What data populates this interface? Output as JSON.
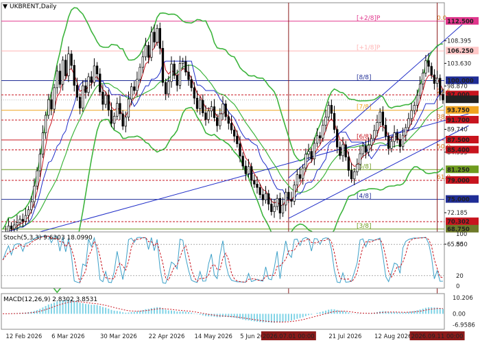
{
  "header": {
    "title_icon": "triangle-down-icon",
    "symbol": "UKBRENT,Daily"
  },
  "chart_data": {
    "type": "line",
    "chart_style": "candlestick",
    "ylim": [
      65.55,
      113.5
    ],
    "y_ticks": [
      {
        "label": "112.500",
        "value": 112.5,
        "boxed": true,
        "color": "#e0368c"
      },
      {
        "label": "108.395",
        "value": 108.395
      },
      {
        "label": "106.250",
        "value": 106.25,
        "boxed": true,
        "color": "#ffc8c8"
      },
      {
        "label": "103.630",
        "value": 103.63
      },
      {
        "label": "100.000",
        "value": 100.0,
        "boxed": true,
        "color": "#1f2d96"
      },
      {
        "label": "98.870",
        "value": 98.87
      },
      {
        "label": "97.000",
        "value": 97.0,
        "boxed": true,
        "color": "#c8141e"
      },
      {
        "label": "95.994",
        "value": 95.994,
        "boxed": true,
        "color": "#222222"
      },
      {
        "label": "93.750",
        "value": 93.75,
        "boxed": true,
        "color": "#f0a31e"
      },
      {
        "label": "91.700",
        "value": 91.7,
        "boxed": true,
        "color": "#c8141e"
      },
      {
        "label": "89.740",
        "value": 89.74
      },
      {
        "label": "87.500",
        "value": 87.5,
        "boxed": true,
        "color": "#c8141e"
      },
      {
        "label": "84.935",
        "value": 84.935
      },
      {
        "label": "85.400",
        "value": 85.4,
        "boxed": true,
        "color": "#c8141e"
      },
      {
        "label": "81.250",
        "value": 81.25,
        "boxed": true,
        "color": "#6e9b1e"
      },
      {
        "label": "79.000",
        "value": 79.0,
        "boxed": true,
        "color": "#c8141e"
      },
      {
        "label": "75.000",
        "value": 75.0,
        "boxed": true,
        "color": "#1f2d96"
      },
      {
        "label": "72.185",
        "value": 72.185
      },
      {
        "label": "70.302",
        "value": 70.302,
        "boxed": true,
        "color": "#c8141e"
      },
      {
        "label": "68.750",
        "value": 68.75,
        "boxed": true,
        "color": "#6e7a2a"
      },
      {
        "label": "65.550",
        "value": 65.55
      }
    ],
    "x_ticks": [
      {
        "label": "12 Feb 2026",
        "index": 2,
        "highlight": false
      },
      {
        "label": "6 Mar 2026",
        "index": 18,
        "highlight": false
      },
      {
        "label": "30 Mar 2026",
        "index": 35,
        "highlight": false
      },
      {
        "label": "22 Apr 2026",
        "index": 52,
        "highlight": false
      },
      {
        "label": "14 May 2026",
        "index": 68,
        "highlight": false
      },
      {
        "label": "5 Jun 2026",
        "index": 84,
        "highlight": false
      },
      {
        "label": "2026.07.01 00:00",
        "index": 100,
        "highlight": true
      },
      {
        "label": "21 Jul 2026",
        "index": 115,
        "highlight": false
      },
      {
        "label": "12 Aug 2026",
        "index": 131,
        "highlight": false
      },
      {
        "label": "2026.09.11 00:00",
        "index": 152,
        "highlight": true
      }
    ],
    "murrey_levels": [
      {
        "value": 112.5,
        "text": "[+2/8]P",
        "color": "#e0368c"
      },
      {
        "value": 106.25,
        "text": "[+1/8]P",
        "color": "#ffb4b4"
      },
      {
        "value": 100.0,
        "text": "[8/8]",
        "color": "#1f2d96"
      },
      {
        "value": 93.75,
        "text": "[7/8]",
        "color": "#f0a31e"
      },
      {
        "value": 87.5,
        "text": "[6/8]",
        "color": "#c8141e"
      },
      {
        "value": 81.25,
        "text": "[5/8]",
        "color": "#6e9b1e"
      },
      {
        "value": 75.0,
        "text": "[4/8]",
        "color": "#1f2d96"
      },
      {
        "value": 68.75,
        "text": "[3/8]",
        "color": "#6e9b1e"
      }
    ],
    "fib_levels": [
      {
        "value": 112.5,
        "text": "0.0"
      },
      {
        "value": 97.0,
        "text": "23.6"
      },
      {
        "value": 91.7,
        "text": "38.2"
      },
      {
        "value": 85.4,
        "text": "50.0"
      },
      {
        "value": 79.0,
        "text": "61.8"
      }
    ],
    "support_resistance": [
      97.0,
      91.7,
      87.5,
      85.4,
      79.0,
      70.302
    ],
    "channel": {
      "upper": [
        {
          "index": 100,
          "value": 79.5
        },
        {
          "index": 163,
          "value": 113.0
        }
      ],
      "lower": [
        {
          "index": 100,
          "value": 71.0
        },
        {
          "index": 163,
          "value": 90.5
        }
      ],
      "long": [
        {
          "index": 0,
          "value": 66.0
        },
        {
          "index": 163,
          "value": 93.0
        }
      ]
    },
    "vertical_markers": [
      100,
      152
    ],
    "candles_close": [
      67.5,
      68.2,
      69.4,
      68.8,
      69.6,
      70.1,
      70.8,
      70.4,
      71.6,
      72.8,
      74.5,
      77.8,
      81.0,
      84.5,
      89.0,
      92.7,
      96.0,
      94.0,
      98.5,
      102.0,
      99.2,
      104.3,
      101.0,
      105.6,
      103.2,
      99.0,
      96.5,
      94.2,
      98.9,
      97.5,
      100.8,
      99.6,
      103.1,
      101.4,
      97.6,
      95.0,
      96.9,
      93.8,
      91.0,
      92.5,
      95.2,
      93.0,
      90.4,
      92.3,
      96.1,
      98.7,
      97.9,
      100.3,
      102.8,
      105.0,
      107.4,
      104.9,
      110.2,
      108.1,
      111.0,
      106.8,
      99.6,
      97.2,
      99.8,
      103.5,
      101.1,
      99.0,
      103.6,
      104.0,
      101.8,
      100.2,
      98.5,
      96.3,
      94.1,
      95.9,
      93.2,
      91.8,
      93.6,
      94.5,
      92.2,
      90.5,
      93.0,
      95.1,
      92.4,
      91.0,
      89.6,
      88.3,
      86.7,
      84.1,
      82.0,
      80.4,
      81.9,
      79.0,
      78.2,
      77.5,
      76.0,
      74.9,
      76.2,
      74.0,
      72.4,
      73.5,
      75.2,
      72.1,
      73.8,
      76.5,
      75.0,
      74.6,
      78.0,
      80.2,
      79.4,
      81.6,
      84.5,
      85.1,
      83.5,
      86.8,
      88.4,
      87.9,
      90.6,
      92.3,
      94.8,
      93.1,
      89.7,
      86.0,
      84.2,
      86.5,
      83.9,
      81.1,
      79.3,
      80.8,
      82.4,
      84.6,
      86.2,
      84.9,
      86.4,
      87.8,
      89.5,
      91.2,
      93.4,
      90.6,
      88.3,
      85.7,
      87.2,
      89.0,
      87.6,
      86.1,
      88.5,
      90.1,
      92.0,
      93.7,
      94.8,
      96.9,
      99.3,
      101.6,
      104.2,
      103.0,
      101.2,
      99.4,
      100.5,
      97.1,
      95.9
    ],
    "stoch_oscillator": {
      "label": "Stoch(5,3,3) 9.6303 18.0990",
      "ylim": [
        0,
        100
      ],
      "levels": [
        80,
        20
      ],
      "ticks": [
        "100",
        "80",
        "20",
        "0"
      ]
    },
    "macd_indicator": {
      "label": "MACD(12,26,9) 2.8302 3.8531",
      "ylim": [
        -8.5,
        11.5
      ],
      "ticks": [
        "10.206",
        "0.00",
        "-6.9586"
      ]
    }
  }
}
